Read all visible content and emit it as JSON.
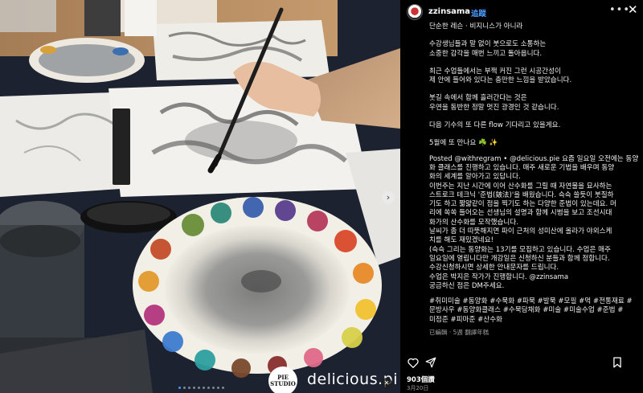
{
  "post": {
    "username": "zzinsama",
    "dot": "•",
    "follow_label": "追蹤",
    "more_icon": "more-options-icon",
    "close_icon": "close-icon",
    "caption_lines": [
      "단순한 레슨 · 비지니스가 아니라",
      "",
      "수강생님들과 말 없이 붓으로도 소통하는",
      "소중한 감각을 매번 느끼고 돌아옵니다.",
      "",
      "최근 수업들에서는 부쩍 커진 그런 시공간성이",
      "제 안에 들어와 있다는 충만한 느낌을 받았습니다.",
      "",
      "붓길 속에서 함께 흘러간다는 것은",
      "우연을 동반한 정말 멋진 광경인 것 같습니다.",
      "",
      "다음 기수의 또 다른 flow 기다리고 있을게요.",
      "",
      "5월에 또 만나요 ☘️ ✨"
    ],
    "description_lines": [
      "Posted @withregram • @delicious.pie 요즘 일요일 오전에는 동양",
      "화 클래스를 진행하고 있습니다. 매주 새로운 기법을 배우며 동양",
      "화의 세계를 알아가고 있답니다.",
      "이번주는 지난 시간에 이어 산수화를 그릴 때 자연물을 묘사하는",
      "스트로크 테크닉 '준법(皴法)'을 배웠습니다. 슥슥 쓸듯이 붓질하",
      "기도 하고 짧얇같이 점을 찍기도 하는 다양한 준법이 있는데요. 머",
      "리에 쏙쏙 들어오는 선생님의 설명과 함께 시범을 보고 조선시대",
      "화가의 산수화를 모작했습니다.",
      "날씨가 좀 더 따뜻해지면 파이 근처의 성미산에 올라가 야외스케",
      "치를 해도 재밌겠네요!",
      "(슥슥 그리는 동양화는 13기를 모집하고 있습니다. 수업은 매주",
      "일요일에 열립니다만 개강일은 신청하신 분들과 함께 정합니다.",
      "수강신청하시면 상세한 안내문자를 드립니다.",
      "수업은 박지은 작가가 진행합니다. @zzinsama",
      "궁금하신 점은 DM주세요."
    ],
    "hashtag_lines": [
      "#취미미술 #동양화 #수묵화 #파묵 #발묵 #모필 #먹 #전통재료 #",
      "문방사우 #동양화클래스 #수묵담채화 #미술 #미술수업 #준법 #",
      "미점준 #피마준 #산수화"
    ],
    "meta_text": "已編輯 · 5週   翻譯年糕",
    "likes": "903個讚",
    "date": "3月20日"
  },
  "actions": {
    "like_icon": "heart-icon",
    "share_icon": "send-icon",
    "save_icon": "bookmark-icon"
  },
  "media": {
    "watermark_text": "delicious.pi",
    "watermark_logo": "PIE STUDIO",
    "carousel_total": 10,
    "carousel_active": 0,
    "next_icon": "chevron-right-icon",
    "mute_icon": "speaker-off-icon"
  }
}
